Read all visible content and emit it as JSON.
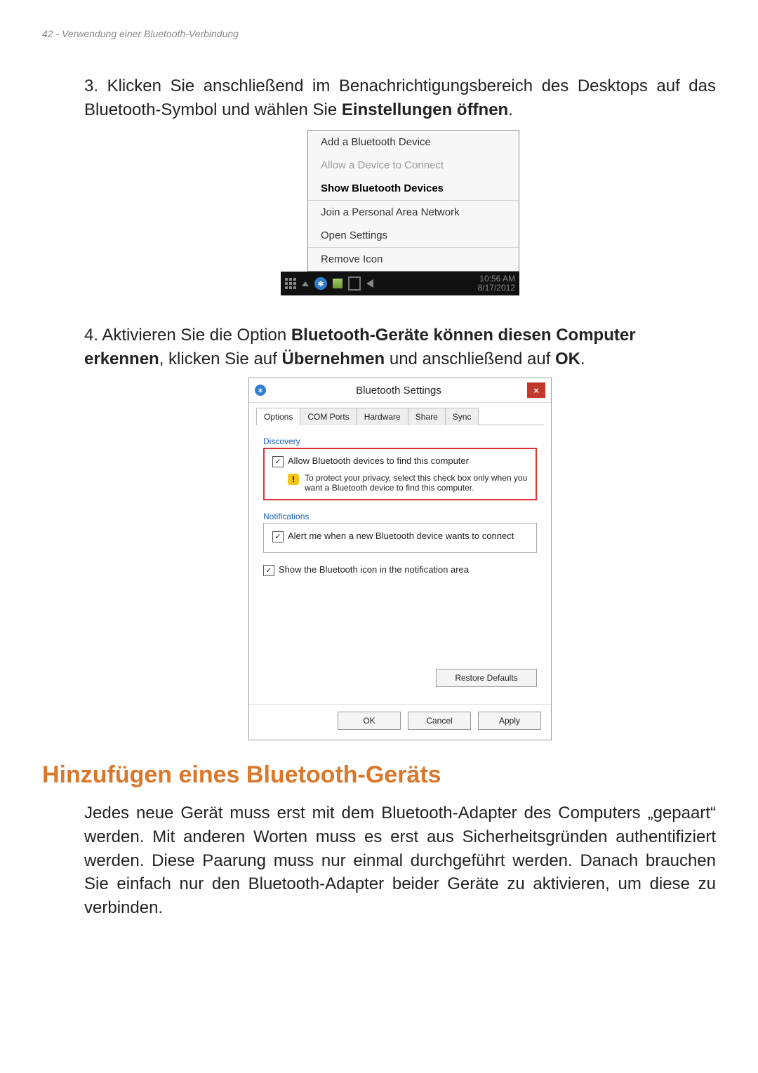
{
  "header": "42 - Verwendung einer Bluetooth-Verbindung",
  "step3": {
    "num": "3.",
    "t1": "Klicken Sie anschließend im Benachrichtigungsbereich des Desktops auf das Bluetooth-Symbol und wählen Sie ",
    "b1": "Einstellungen öffnen",
    "t2": "."
  },
  "ctx": {
    "add": "Add a Bluetooth Device",
    "allow": "Allow a Device to Connect",
    "show": "Show Bluetooth Devices",
    "join": "Join a Personal Area Network",
    "open": "Open Settings",
    "remove": "Remove Icon"
  },
  "taskbar": {
    "time": "10:56 AM",
    "date": "8/17/2012"
  },
  "step4": {
    "num": "4.",
    "t1": "Aktivieren Sie die Option ",
    "b1": "Bluetooth-Geräte können diesen Computer erkennen",
    "t2": ", klicken Sie auf ",
    "b2": "Übernehmen",
    "t3": " und anschließend auf ",
    "b3": "OK",
    "t4": "."
  },
  "dlg": {
    "title": "Bluetooth Settings",
    "tabs": [
      "Options",
      "COM Ports",
      "Hardware",
      "Share",
      "Sync"
    ],
    "discovery_label": "Discovery",
    "allow_find": "Allow Bluetooth devices to find this computer",
    "privacy_hint": "To protect your privacy, select this check box only when you want a Bluetooth device to find this computer.",
    "notifications_label": "Notifications",
    "alert_new": "Alert me when a new Bluetooth device wants to connect",
    "show_icon": "Show the Bluetooth icon in the notification area",
    "restore": "Restore Defaults",
    "ok": "OK",
    "cancel": "Cancel",
    "apply": "Apply"
  },
  "h2": "Hinzufügen eines Bluetooth-Geräts",
  "para": "Jedes neue Gerät muss erst mit dem Bluetooth-Adapter des Computers „gepaart“ werden. Mit anderen Worten muss es erst aus Sicherheitsgründen authentifiziert werden. Diese Paarung muss nur einmal durchgeführt werden. Danach brauchen Sie einfach nur den Bluetooth-Adapter beider Geräte zu aktivieren, um diese zu verbinden."
}
